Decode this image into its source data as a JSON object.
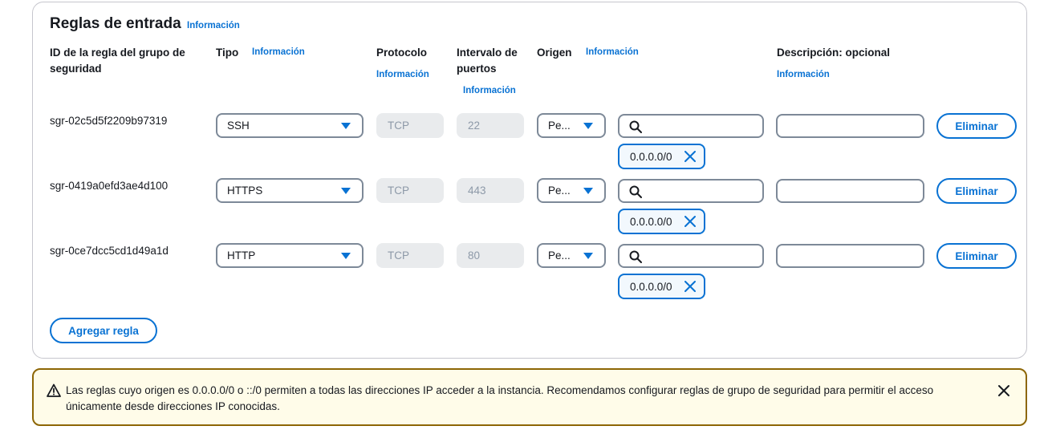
{
  "panel": {
    "title": "Reglas de entrada",
    "title_info": "Información"
  },
  "columns": {
    "rule_id": "ID de la regla del grupo de seguridad",
    "type": "Tipo",
    "type_info": "Información",
    "protocol": "Protocolo",
    "protocol_info": "Información",
    "port_range": "Intervalo de puertos",
    "port_range_info": "Información",
    "source": "Origen",
    "source_info": "Información",
    "description": "Descripción: opcional",
    "description_info": "Información"
  },
  "rules": [
    {
      "id": "sgr-02c5d5f2209b97319",
      "type": "SSH",
      "protocol": "TCP",
      "port": "22",
      "source_type": "Pe...",
      "search_value": "",
      "cidr": "0.0.0.0/0",
      "description": "",
      "delete_label": "Eliminar"
    },
    {
      "id": "sgr-0419a0efd3ae4d100",
      "type": "HTTPS",
      "protocol": "TCP",
      "port": "443",
      "source_type": "Pe...",
      "search_value": "",
      "cidr": "0.0.0.0/0",
      "description": "",
      "delete_label": "Eliminar"
    },
    {
      "id": "sgr-0ce7dcc5cd1d49a1d",
      "type": "HTTP",
      "protocol": "TCP",
      "port": "80",
      "source_type": "Pe...",
      "search_value": "",
      "cidr": "0.0.0.0/0",
      "description": "",
      "delete_label": "Eliminar"
    }
  ],
  "add_rule_label": "Agregar regla",
  "alert": {
    "text": "Las reglas cuyo origen es 0.0.0.0/0 o ::/0 permiten a todas las direcciones IP acceder a la instancia. Recomendamos configurar reglas de grupo de seguridad para permitir el acceso únicamente desde direcciones IP conocidas."
  },
  "colors": {
    "accent": "#0972d3",
    "warning_border": "#8d6605",
    "warning_bg": "#fffce9",
    "input_border": "#7d8998",
    "disabled_bg": "#e9ebed"
  }
}
